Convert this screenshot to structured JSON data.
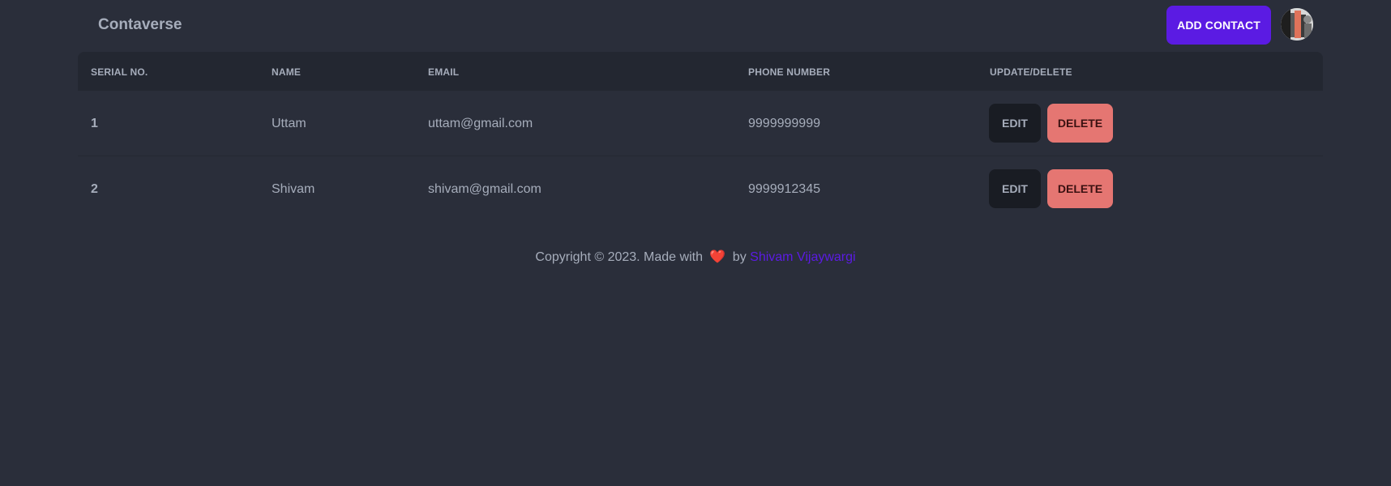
{
  "navbar": {
    "brand": "Contaverse",
    "add_button_label": "ADD CONTACT",
    "avatar_icon": "user-avatar"
  },
  "table": {
    "headers": [
      "SERIAL NO.",
      "NAME",
      "EMAIL",
      "PHONE NUMBER",
      "UPDATE/DELETE"
    ],
    "rows": [
      {
        "serial": "1",
        "name": "Uttam",
        "email": "uttam@gmail.com",
        "phone": "9999999999",
        "edit_label": "EDIT",
        "delete_label": "DELETE"
      },
      {
        "serial": "2",
        "name": "Shivam",
        "email": "shivam@gmail.com",
        "phone": "9999912345",
        "edit_label": "EDIT",
        "delete_label": "DELETE"
      }
    ]
  },
  "footer": {
    "prefix": "Copyright © 2023. Made with",
    "heart_icon": "heart-icon",
    "by_text": "by",
    "author": "Shivam Vijaywargi"
  },
  "colors": {
    "background": "#2a2e3a",
    "header_bg": "#232731",
    "primary": "#5b1be3",
    "delete": "#e57672",
    "edit": "#191c23",
    "heart": "#e0242e"
  }
}
